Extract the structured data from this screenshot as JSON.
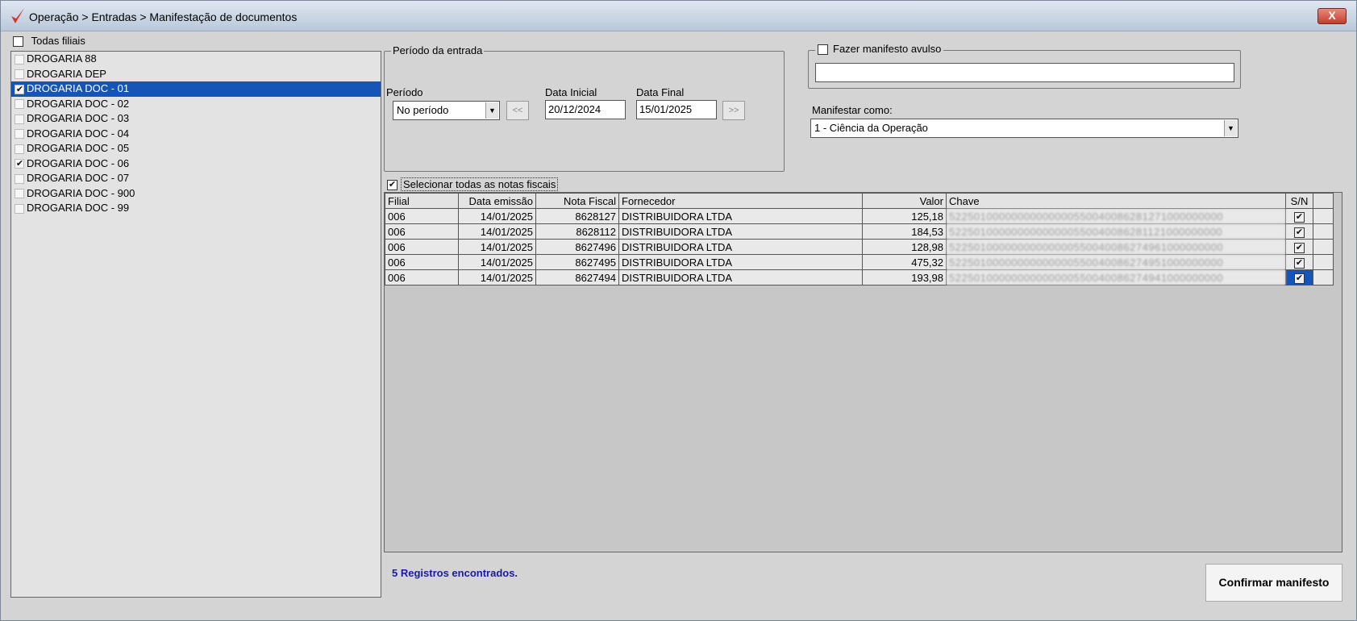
{
  "window": {
    "title": "Operação > Entradas > Manifestação de documentos",
    "close_label": "X"
  },
  "branches": {
    "all_label": "Todas filiais",
    "all_checked": false,
    "items": [
      {
        "label": "DROGARIA 88",
        "checked": false,
        "selected": false
      },
      {
        "label": "DROGARIA DEP",
        "checked": false,
        "selected": false
      },
      {
        "label": "DROGARIA DOC - 01",
        "checked": true,
        "selected": true
      },
      {
        "label": "DROGARIA DOC - 02",
        "checked": false,
        "selected": false
      },
      {
        "label": "DROGARIA DOC - 03",
        "checked": false,
        "selected": false
      },
      {
        "label": "DROGARIA DOC - 04",
        "checked": false,
        "selected": false
      },
      {
        "label": "DROGARIA DOC - 05",
        "checked": false,
        "selected": false
      },
      {
        "label": "DROGARIA DOC - 06",
        "checked": true,
        "selected": false
      },
      {
        "label": "DROGARIA DOC - 07",
        "checked": false,
        "selected": false
      },
      {
        "label": "DROGARIA DOC - 900",
        "checked": false,
        "selected": false
      },
      {
        "label": "DROGARIA DOC - 99",
        "checked": false,
        "selected": false
      }
    ]
  },
  "period": {
    "group_label": "Período da entrada",
    "period_label": "Período",
    "period_value": "No período",
    "start_label": "Data Inicial",
    "start_value": "20/12/2024",
    "end_label": "Data Final",
    "end_value": "15/01/2025",
    "prev_label": "<<",
    "next_label": ">>"
  },
  "avulso": {
    "label": "Fazer manifesto avulso",
    "checked": false,
    "value": ""
  },
  "manifestar": {
    "label": "Manifestar como:",
    "value": "1 - Ciência da Operação"
  },
  "select_all": {
    "label": "Selecionar todas as notas fiscais",
    "checked": true
  },
  "table": {
    "columns": [
      "Filial",
      "Data emissão",
      "Nota Fiscal",
      "Fornecedor",
      "Valor",
      "Chave",
      "S/N"
    ],
    "rows": [
      {
        "filial": "006",
        "data": "14/01/2025",
        "nota": "8628127",
        "fornecedor": "DISTRIBUIDORA  LTDA",
        "valor": "125,18",
        "chave": "52250100000000000000550040086281271000000000",
        "sn": true
      },
      {
        "filial": "006",
        "data": "14/01/2025",
        "nota": "8628112",
        "fornecedor": "DISTRIBUIDORA  LTDA",
        "valor": "184,53",
        "chave": "52250100000000000000550040086281121000000000",
        "sn": true
      },
      {
        "filial": "006",
        "data": "14/01/2025",
        "nota": "8627496",
        "fornecedor": "DISTRIBUIDORA  LTDA",
        "valor": "128,98",
        "chave": "52250100000000000000550040086274961000000000",
        "sn": true
      },
      {
        "filial": "006",
        "data": "14/01/2025",
        "nota": "8627495",
        "fornecedor": "DISTRIBUIDORA  LTDA",
        "valor": "475,32",
        "chave": "52250100000000000000550040086274951000000000",
        "sn": true
      },
      {
        "filial": "006",
        "data": "14/01/2025",
        "nota": "8627494",
        "fornecedor": "DISTRIBUIDORA  LTDA",
        "valor": "193,98",
        "chave": "52250100000000000000550040086274941000000000",
        "sn": true
      }
    ]
  },
  "status": {
    "records_text": "5 Registros encontrados."
  },
  "actions": {
    "confirm_label": "Confirmar manifesto"
  },
  "colors": {
    "selection": "#1555b8",
    "records_text": "#1a1aa6",
    "app_icon": "#d9332a"
  },
  "icons": {
    "app": "checkmark-logo-icon",
    "dropdown": "chevron-down-icon"
  }
}
